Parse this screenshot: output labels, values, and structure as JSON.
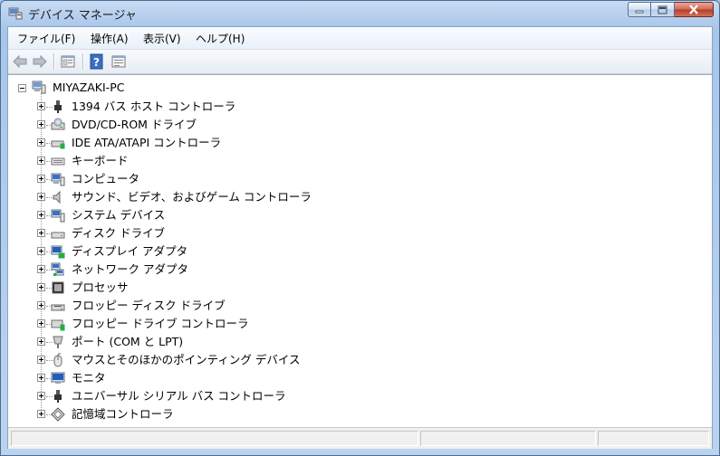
{
  "window": {
    "title": "デバイス マネージャ"
  },
  "menu": [
    {
      "label": "ファイル(F)"
    },
    {
      "label": "操作(A)"
    },
    {
      "label": "表示(V)"
    },
    {
      "label": "ヘルプ(H)"
    }
  ],
  "toolbar": [
    "back-arrow-icon",
    "forward-arrow-icon",
    "properties-icon",
    "help-icon",
    "view-icon"
  ],
  "tree": {
    "root": "MIYAZAKI-PC",
    "items": [
      {
        "label": "1394 バス ホスト コントローラ",
        "icon": "usb-plug-icon"
      },
      {
        "label": "DVD/CD-ROM ドライブ",
        "icon": "optical-drive-icon"
      },
      {
        "label": "IDE ATA/ATAPI コントローラ",
        "icon": "ide-controller-icon"
      },
      {
        "label": "キーボード",
        "icon": "keyboard-icon"
      },
      {
        "label": "コンピュータ",
        "icon": "computer-icon"
      },
      {
        "label": "サウンド、ビデオ、およびゲーム コントローラ",
        "icon": "speaker-icon"
      },
      {
        "label": "システム デバイス",
        "icon": "system-device-icon"
      },
      {
        "label": "ディスク ドライブ",
        "icon": "disk-drive-icon"
      },
      {
        "label": "ディスプレイ アダプタ",
        "icon": "display-adapter-icon"
      },
      {
        "label": "ネットワーク アダプタ",
        "icon": "network-adapter-icon"
      },
      {
        "label": "プロセッサ",
        "icon": "processor-icon"
      },
      {
        "label": "フロッピー ディスク ドライブ",
        "icon": "floppy-drive-icon"
      },
      {
        "label": "フロッピー ドライブ コントローラ",
        "icon": "floppy-controller-icon"
      },
      {
        "label": "ポート (COM と LPT)",
        "icon": "port-icon"
      },
      {
        "label": "マウスとそのほかのポインティング デバイス",
        "icon": "mouse-icon"
      },
      {
        "label": "モニタ",
        "icon": "monitor-icon"
      },
      {
        "label": "ユニバーサル シリアル バス コントローラ",
        "icon": "usb-controller-icon"
      },
      {
        "label": "記憶域コントローラ",
        "icon": "storage-controller-icon"
      }
    ]
  }
}
